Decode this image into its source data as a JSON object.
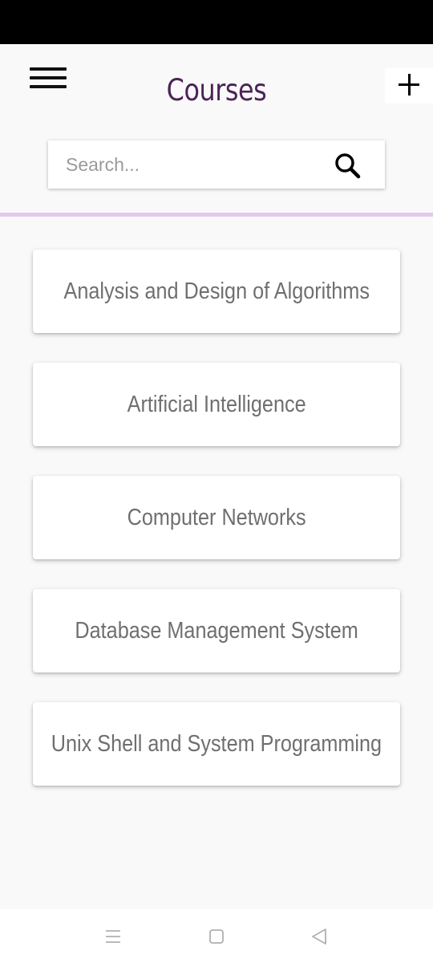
{
  "header": {
    "title": "Courses",
    "menu_icon": "hamburger-menu-icon",
    "add_icon": "plus-icon"
  },
  "search": {
    "placeholder": "Search...",
    "value": "",
    "icon": "search-icon"
  },
  "courses": [
    {
      "label": "Analysis and Design of Algorithms"
    },
    {
      "label": "Artificial Intelligence"
    },
    {
      "label": "Computer Networks"
    },
    {
      "label": "Database Management System"
    },
    {
      "label": "Unix Shell and System Programming"
    }
  ],
  "nav_bar": {
    "icons": [
      "recent-apps-icon",
      "home-icon",
      "back-icon"
    ]
  },
  "colors": {
    "title": "#4a2456",
    "divider": "#e4c8ec",
    "status_bar": "#000000",
    "card_text": "#6f6f6f"
  }
}
